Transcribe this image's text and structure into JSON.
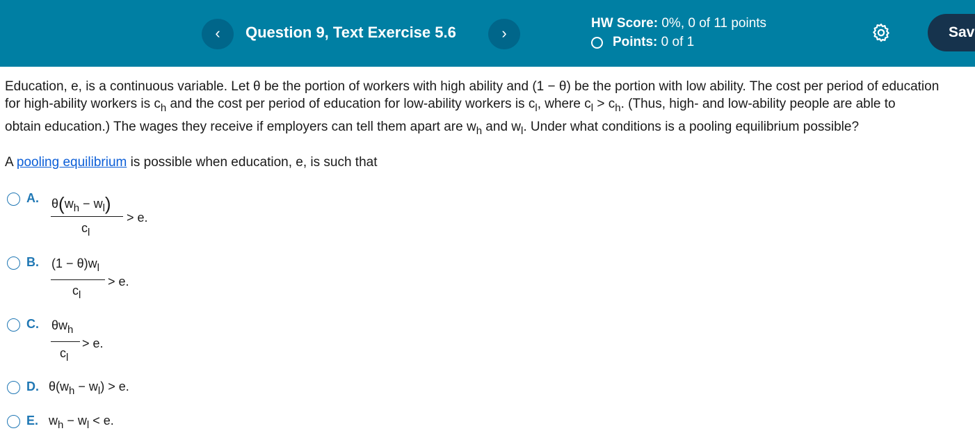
{
  "header": {
    "prev_label": "‹",
    "next_label": "›",
    "question_title": "Question 9, Text Exercise 5.6",
    "hw_score_label": "HW Score:",
    "hw_score_value": "0%, 0 of 11 points",
    "points_label": "Points:",
    "points_value": "0 of 1",
    "settings_icon": "gear-icon",
    "save_label": "Sav",
    "colors": {
      "bar": "#007fa3",
      "nav_button": "#00668a",
      "save_button": "#16334d"
    }
  },
  "question": {
    "line1": "Education, e, is a continuous variable.  Let θ be the portion of workers with high ability and (1 − θ) be the portion with low ability.  The cost per period of education",
    "line2_a": "for high-ability workers is c",
    "line2_b": "h",
    "line2_c": " and the cost per period of education for low-ability workers is c",
    "line2_d": "l",
    "line2_e": ", where c",
    "line2_f": "l",
    "line2_g": " > c",
    "line2_h": "h",
    "line2_i": ".  (Thus, high- and low-ability people are able to",
    "line3_a": "obtain education.)  The wages they receive if employers can tell them apart are w",
    "line3_b": "h",
    "line3_c": " and w",
    "line3_d": "l",
    "line3_e": ".  Under what conditions is a pooling equilibrium possible?",
    "prompt_a": "A ",
    "prompt_link": "pooling equilibrium",
    "prompt_b": " is possible when education, e, is such that"
  },
  "options": [
    {
      "letter": "A.",
      "numerator": "θ(w_h − w_l)",
      "denominator": "c_l",
      "tail": "> e."
    },
    {
      "letter": "B.",
      "numerator": "(1 − θ)w_l",
      "denominator": "c_l",
      "tail": "> e."
    },
    {
      "letter": "C.",
      "numerator": "θw_h",
      "denominator": "c_l",
      "tail": "> e."
    },
    {
      "letter": "D.",
      "expression": "θ(w_h − w_l) > e."
    },
    {
      "letter": "E.",
      "expression": "w_h − w_l < e."
    }
  ],
  "symbols": {
    "theta": "θ",
    "minus": "−",
    "w": "w",
    "c": "c",
    "h": "h",
    "l": "l",
    "e": "e.",
    "gt": ">",
    "lt": "<",
    "one": "1",
    "lparen": "(",
    "rparen": ")"
  }
}
